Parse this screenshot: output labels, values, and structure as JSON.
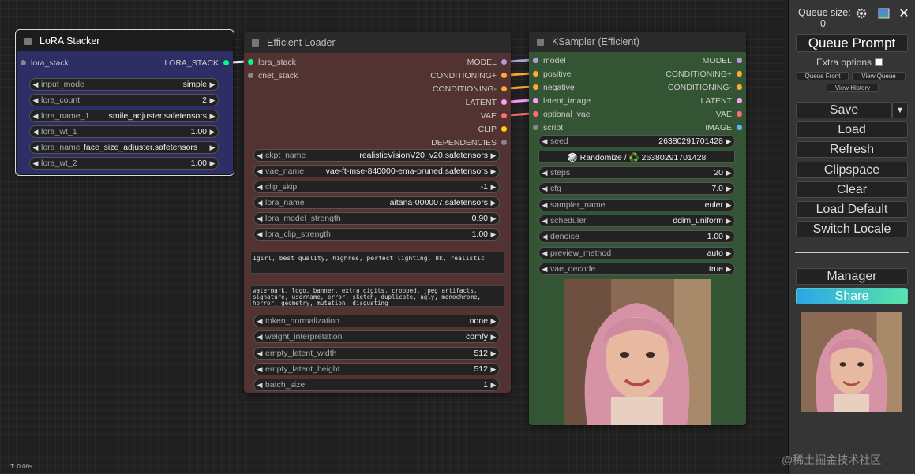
{
  "colors": {
    "model": "#b39ddb",
    "conditioning": "#ffa931",
    "latent": "#ff9cf9",
    "vae": "#ff6e6e",
    "clip": "#ffd500",
    "lora": "#00ff7f",
    "image": "#64b5f6",
    "generic": "#888888"
  },
  "lora_stacker": {
    "title": "LoRA Stacker",
    "input": "lora_stack",
    "output": "LORA_STACK",
    "widgets": [
      {
        "label": "input_mode",
        "value": "simple"
      },
      {
        "label": "lora_count",
        "value": "2"
      },
      {
        "label": "lora_name_1",
        "value": "smile_adjuster.safetensors"
      },
      {
        "label": "lora_wt_1",
        "value": "1.00"
      },
      {
        "label": "lora_name_2",
        "value": "face_size_adjuster.safetensors"
      },
      {
        "label": "lora_wt_2",
        "value": "1.00"
      }
    ]
  },
  "efficient_loader": {
    "title": "Efficient Loader",
    "inputs": [
      "lora_stack",
      "cnet_stack"
    ],
    "outputs": [
      "MODEL",
      "CONDITIONING+",
      "CONDITIONING-",
      "LATENT",
      "VAE",
      "CLIP",
      "DEPENDENCIES"
    ],
    "widgets_top": [
      {
        "label": "ckpt_name",
        "value": "realisticVisionV20_v20.safetensors"
      },
      {
        "label": "vae_name",
        "value": "vae-ft-mse-840000-ema-pruned.safetensors"
      },
      {
        "label": "clip_skip",
        "value": "-1"
      },
      {
        "label": "lora_name",
        "value": "aitana-000007.safetensors"
      },
      {
        "label": "lora_model_strength",
        "value": "0.90"
      },
      {
        "label": "lora_clip_strength",
        "value": "1.00"
      }
    ],
    "positive_prompt": "1girl, best quality, highres, perfect lighting, 8k, realistic",
    "negative_prompt": "watermark, logo, banner, extra digits, cropped, jpeg artifacts, signature, username, error, sketch, duplicate, ugly, monochrome, horror, geometry, mutation, disgusting",
    "widgets_bottom": [
      {
        "label": "token_normalization",
        "value": "none"
      },
      {
        "label": "weight_interpretation",
        "value": "comfy"
      },
      {
        "label": "empty_latent_width",
        "value": "512"
      },
      {
        "label": "empty_latent_height",
        "value": "512"
      },
      {
        "label": "batch_size",
        "value": "1"
      }
    ]
  },
  "ksampler": {
    "title": "KSampler (Efficient)",
    "inputs": [
      "model",
      "positive",
      "negative",
      "latent_image",
      "optional_vae",
      "script"
    ],
    "outputs": [
      "MODEL",
      "CONDITIONING+",
      "CONDITIONING-",
      "LATENT",
      "VAE",
      "IMAGE"
    ],
    "seed": {
      "label": "seed",
      "value": "26380291701428"
    },
    "randomize_label": "🎲 Randomize / ♻️ 26380291701428",
    "widgets": [
      {
        "label": "steps",
        "value": "20"
      },
      {
        "label": "cfg",
        "value": "7.0"
      },
      {
        "label": "sampler_name",
        "value": "euler"
      },
      {
        "label": "scheduler",
        "value": "ddim_uniform"
      },
      {
        "label": "denoise",
        "value": "1.00"
      },
      {
        "label": "preview_method",
        "value": "auto"
      },
      {
        "label": "vae_decode",
        "value": "true"
      }
    ]
  },
  "menu": {
    "queue_size_label": "Queue size:",
    "queue_count": "0",
    "queue_prompt": "Queue Prompt",
    "extra_options": "Extra options",
    "queue_front": "Queue Front",
    "view_queue": "View Queue",
    "view_history": "View History",
    "save": "Save",
    "load": "Load",
    "refresh": "Refresh",
    "clipspace": "Clipspace",
    "clear": "Clear",
    "load_default": "Load Default",
    "switch_locale": "Switch Locale",
    "manager": "Manager",
    "share": "Share"
  },
  "timer": "T: 0.00s",
  "watermark": "@稀土掘金技术社区"
}
